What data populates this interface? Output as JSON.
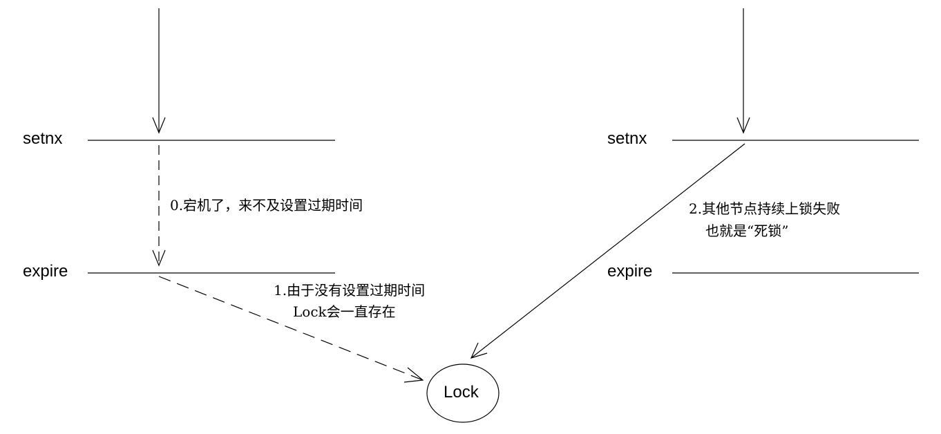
{
  "labels": {
    "left_setnx": "setnx",
    "left_expire": "expire",
    "right_setnx": "setnx",
    "right_expire": "expire",
    "lock": "Lock"
  },
  "annotations": {
    "crash": "0.宕机了，来不及设置过期时间",
    "no_expire_line1": "1.由于没有设置过期时间",
    "no_expire_line2": "Lock会一直存在",
    "deadlock_line1": "2.其他节点持续上锁失败",
    "deadlock_line2": "也就是“死锁”"
  }
}
